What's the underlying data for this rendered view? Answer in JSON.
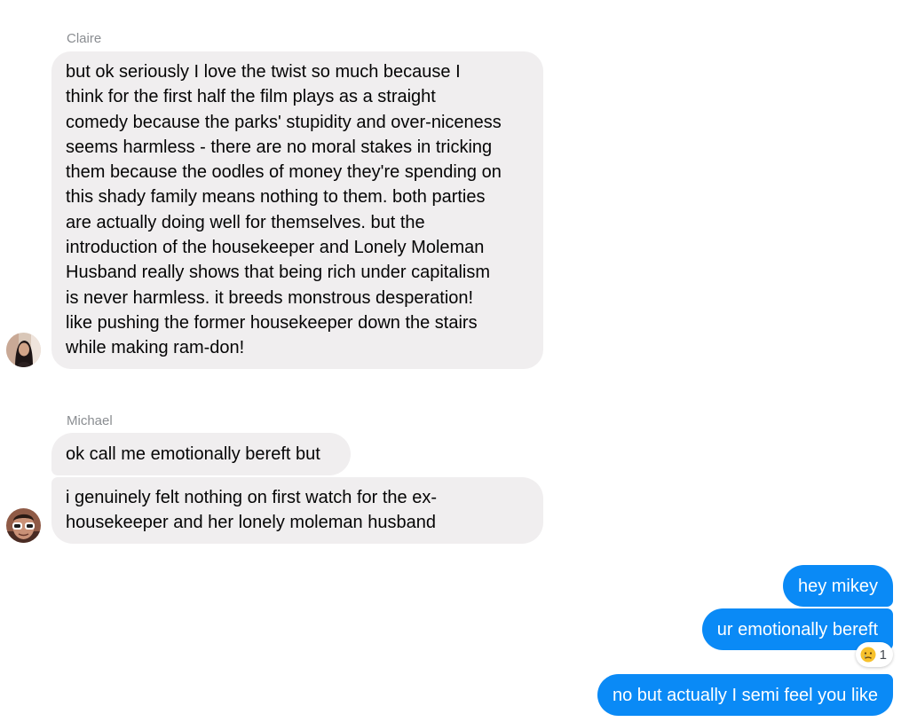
{
  "conversation": {
    "groups": [
      {
        "sender": "Claire",
        "messages": [
          "but ok seriously I love the twist so much because I\nthink for the first half the film plays as a straight\ncomedy because the parks' stupidity and over-niceness\nseems harmless - there are no moral stakes in tricking\nthem because the oodles of money they're spending on\nthis shady family means nothing to them. both parties\nare actually doing well for themselves. but the\nintroduction of the housekeeper and Lonely Moleman\nHusband really shows that being rich under capitalism\nis never harmless. it breeds monstrous desperation!\nlike pushing the former housekeeper down the stairs\nwhile making ram-don!"
        ]
      },
      {
        "sender": "Michael",
        "messages": [
          "ok call me emotionally bereft but",
          "i genuinely felt nothing on first watch for the ex-\nhousekeeper and her lonely moleman husband"
        ]
      }
    ],
    "outgoing": [
      "hey mikey",
      "ur emotionally bereft",
      "no but actually I semi feel you like"
    ],
    "reaction": {
      "emoji": "crying-face-icon",
      "count": "1"
    }
  },
  "colors": {
    "incoming_bubble": "#f0eeef",
    "outgoing_bubble": "#0a8af6",
    "sender_name": "#8a8d91",
    "background": "#ffffff"
  }
}
